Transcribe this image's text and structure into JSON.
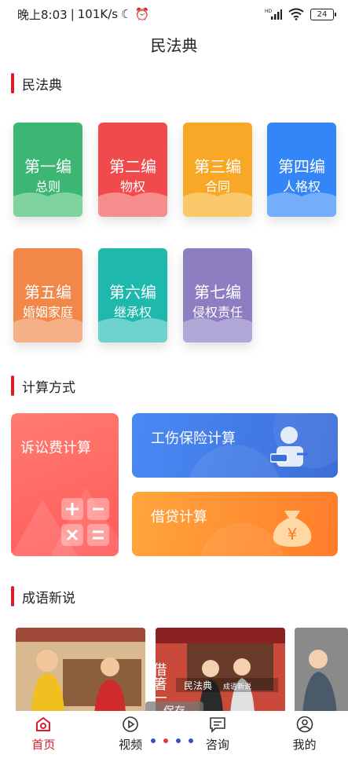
{
  "status_bar": {
    "time": "晚上8:03",
    "speed": "101K/s",
    "battery": "24",
    "network_tag": "HD"
  },
  "header": {
    "title": "民法典"
  },
  "sections": {
    "civil_code": "民法典",
    "calc": "计算方式",
    "idioms": "成语新说"
  },
  "books": [
    {
      "volume": "第一编",
      "name": "总则",
      "color": "#3db673",
      "wave": "#7fd39f"
    },
    {
      "volume": "第二编",
      "name": "物权",
      "color": "#f04a4d",
      "wave": "#f78c8c"
    },
    {
      "volume": "第三编",
      "name": "合同",
      "color": "#f8a726",
      "wave": "#fbc96a"
    },
    {
      "volume": "第四编",
      "name": "人格权",
      "color": "#3486f6",
      "wave": "#74aefa"
    },
    {
      "volume": "第五编",
      "name": "婚姻家庭",
      "color": "#f2874a",
      "wave": "#f6b086"
    },
    {
      "volume": "第六编",
      "name": "继承权",
      "color": "#1fb8ad",
      "wave": "#6cd4cd"
    },
    {
      "volume": "第七编",
      "name": "侵权责任",
      "color": "#8c7ec1",
      "wave": "#b2a8d8"
    }
  ],
  "calc": {
    "litigation": "诉讼费计算",
    "injury": "工伤保险计算",
    "loan": "借贷计算",
    "yen_symbol": "¥"
  },
  "idioms": {
    "image2_caption": "民法典",
    "image2_subcaption": "成语新说",
    "image2_title": "借箸一"
  },
  "overlay": {
    "save": "保存"
  },
  "nav": [
    {
      "label": "首页",
      "icon": "home-icon",
      "active": true
    },
    {
      "label": "视频",
      "icon": "play-icon",
      "active": false
    },
    {
      "label": "咨询",
      "icon": "message-icon",
      "active": false
    },
    {
      "label": "我的",
      "icon": "profile-icon",
      "active": false
    }
  ],
  "colors": {
    "accent": "#d81e2c"
  }
}
